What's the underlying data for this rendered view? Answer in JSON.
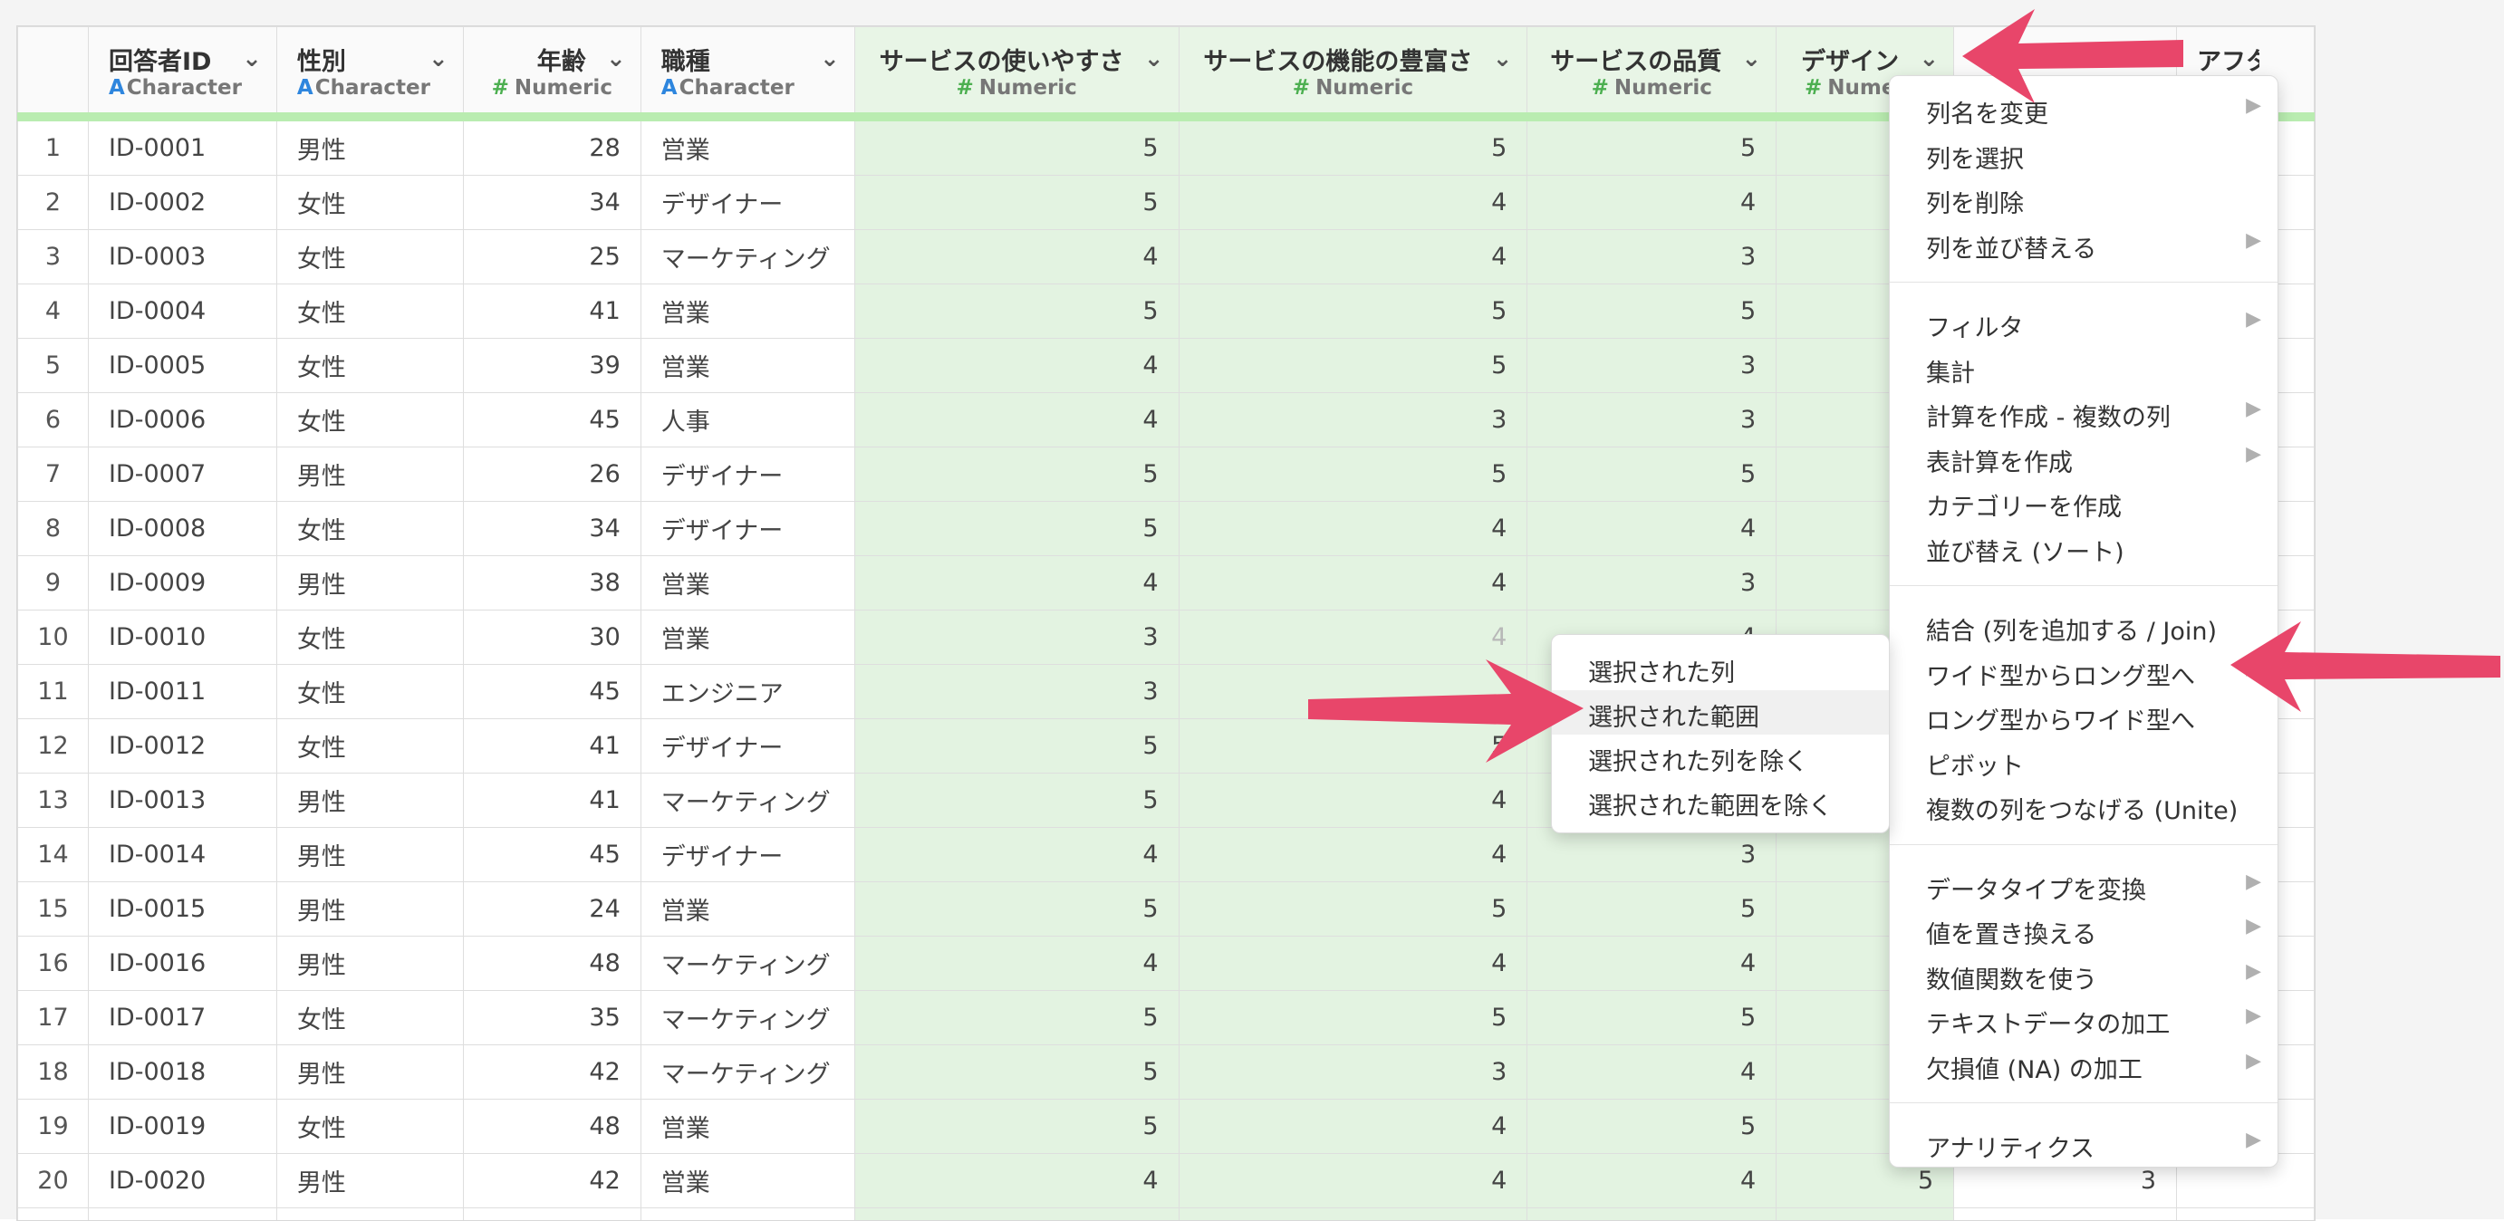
{
  "columns": [
    {
      "name": "",
      "type": "",
      "kind": "rownum"
    },
    {
      "name": "回答者ID",
      "type": "Character",
      "kind": "char"
    },
    {
      "name": "性別",
      "type": "Character",
      "kind": "char"
    },
    {
      "name": "年齢",
      "type": "Numeric",
      "kind": "num"
    },
    {
      "name": "職種",
      "type": "Character",
      "kind": "char"
    },
    {
      "name": "サービスの使いやすさ",
      "type": "Numeric",
      "kind": "num",
      "selected": true
    },
    {
      "name": "サービスの機能の豊富さ",
      "type": "Numeric",
      "kind": "num",
      "selected": true
    },
    {
      "name": "サービスの品質",
      "type": "Numeric",
      "kind": "num",
      "selected": true
    },
    {
      "name": "デザイン",
      "type": "Numeric",
      "kind": "num",
      "selected": true
    },
    {
      "name": "",
      "type": "",
      "kind": "num"
    },
    {
      "name": "アフターフ",
      "type": "",
      "kind": "char"
    }
  ],
  "rows": [
    [
      "1",
      "ID-0001",
      "男性",
      "28",
      "営業",
      "5",
      "5",
      "5",
      "",
      ""
    ],
    [
      "2",
      "ID-0002",
      "女性",
      "34",
      "デザイナー",
      "5",
      "4",
      "4",
      "",
      ""
    ],
    [
      "3",
      "ID-0003",
      "女性",
      "25",
      "マーケティング",
      "4",
      "4",
      "3",
      "",
      ""
    ],
    [
      "4",
      "ID-0004",
      "女性",
      "41",
      "営業",
      "5",
      "5",
      "5",
      "",
      ""
    ],
    [
      "5",
      "ID-0005",
      "女性",
      "39",
      "営業",
      "4",
      "5",
      "3",
      "",
      ""
    ],
    [
      "6",
      "ID-0006",
      "女性",
      "45",
      "人事",
      "4",
      "3",
      "3",
      "",
      ""
    ],
    [
      "7",
      "ID-0007",
      "男性",
      "26",
      "デザイナー",
      "5",
      "5",
      "5",
      "",
      ""
    ],
    [
      "8",
      "ID-0008",
      "女性",
      "34",
      "デザイナー",
      "5",
      "4",
      "4",
      "",
      ""
    ],
    [
      "9",
      "ID-0009",
      "男性",
      "38",
      "営業",
      "4",
      "4",
      "3",
      "",
      ""
    ],
    [
      "10",
      "ID-0010",
      "女性",
      "30",
      "営業",
      "3",
      "4",
      "4",
      "",
      ""
    ],
    [
      "11",
      "ID-0011",
      "女性",
      "45",
      "エンジニア",
      "3",
      "",
      "",
      "",
      ""
    ],
    [
      "12",
      "ID-0012",
      "女性",
      "41",
      "デザイナー",
      "5",
      "5",
      "",
      "",
      ""
    ],
    [
      "13",
      "ID-0013",
      "男性",
      "41",
      "マーケティング",
      "5",
      "4",
      "",
      "",
      ""
    ],
    [
      "14",
      "ID-0014",
      "男性",
      "45",
      "デザイナー",
      "4",
      "4",
      "3",
      "",
      ""
    ],
    [
      "15",
      "ID-0015",
      "男性",
      "24",
      "営業",
      "5",
      "5",
      "5",
      "",
      ""
    ],
    [
      "16",
      "ID-0016",
      "男性",
      "48",
      "マーケティング",
      "4",
      "4",
      "4",
      "",
      ""
    ],
    [
      "17",
      "ID-0017",
      "女性",
      "35",
      "マーケティング",
      "5",
      "5",
      "5",
      "",
      ""
    ],
    [
      "18",
      "ID-0018",
      "男性",
      "42",
      "マーケティング",
      "5",
      "3",
      "4",
      "",
      ""
    ],
    [
      "19",
      "ID-0019",
      "女性",
      "48",
      "営業",
      "5",
      "4",
      "5",
      "",
      ""
    ],
    [
      "20",
      "ID-0020",
      "男性",
      "42",
      "営業",
      "4",
      "4",
      "4",
      "5",
      "3"
    ],
    [
      "",
      "",
      "",
      "",
      "",
      "",
      "",
      "",
      "",
      ""
    ]
  ],
  "context_menu": {
    "groups": [
      [
        {
          "label": "列名を変更",
          "sub": true
        },
        {
          "label": "列を選択",
          "sub": false
        },
        {
          "label": "列を削除",
          "sub": false
        },
        {
          "label": "列を並び替える",
          "sub": true
        }
      ],
      [
        {
          "label": "フィルタ",
          "sub": true
        },
        {
          "label": "集計",
          "sub": false
        },
        {
          "label": "計算を作成 - 複数の列",
          "sub": true
        },
        {
          "label": "表計算を作成",
          "sub": true
        },
        {
          "label": "カテゴリーを作成",
          "sub": false
        },
        {
          "label": "並び替え (ソート)",
          "sub": false
        }
      ],
      [
        {
          "label": "結合 (列を追加する / Join)",
          "sub": false
        },
        {
          "label": "ワイド型からロング型へ",
          "sub": true
        },
        {
          "label": "ロング型からワイド型へ",
          "sub": false
        },
        {
          "label": "ピボット",
          "sub": false
        },
        {
          "label": "複数の列をつなげる (Unite)",
          "sub": false
        }
      ],
      [
        {
          "label": "データタイプを変換",
          "sub": true
        },
        {
          "label": "値を置き換える",
          "sub": true
        },
        {
          "label": "数値関数を使う",
          "sub": true
        },
        {
          "label": "テキストデータの加工",
          "sub": true
        },
        {
          "label": "欠損値 (NA) の加工",
          "sub": true
        }
      ],
      [
        {
          "label": "アナリティクス",
          "sub": true
        }
      ]
    ]
  },
  "submenu": {
    "items": [
      {
        "label": "選択された列",
        "highlighted": false
      },
      {
        "label": "選択された範囲",
        "highlighted": true
      },
      {
        "label": "選択された列を除く",
        "highlighted": false
      },
      {
        "label": "選択された範囲を除く",
        "highlighted": false
      }
    ]
  },
  "colors": {
    "selected_column_bg": "#e3f3e1",
    "header_underline": "#b9ecb0",
    "annotation_arrow": "#e8466a",
    "char_type_icon": "#2e86de",
    "numeric_type_icon": "#4caf50"
  },
  "icons": {
    "column_menu": "chevron-down-icon",
    "submenu_indicator": "chevron-right-icon",
    "character_type": "character-type-icon",
    "numeric_type": "numeric-type-icon"
  }
}
